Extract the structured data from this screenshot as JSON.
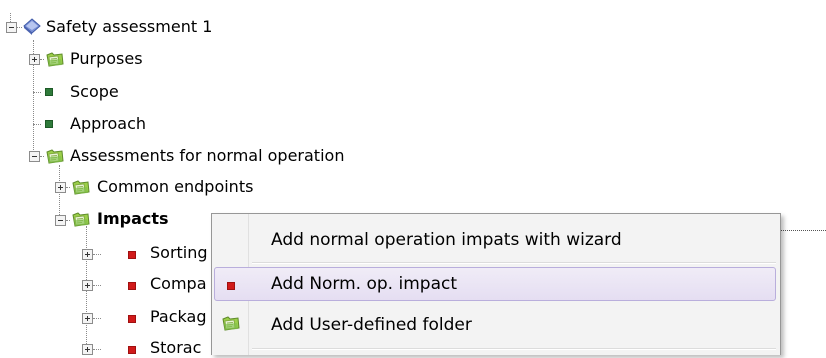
{
  "tree": {
    "root": {
      "label": "Safety assessment 1"
    },
    "purposes": {
      "label": "Purposes"
    },
    "scope": {
      "label": "Scope"
    },
    "approach": {
      "label": "Approach"
    },
    "assessments": {
      "label": "Assessments for normal operation"
    },
    "common_endpoints": {
      "label": "Common endpoints"
    },
    "impacts": {
      "label": "Impacts"
    },
    "children": [
      {
        "label": "Sorting"
      },
      {
        "label": "Compa"
      },
      {
        "label": "Packag"
      },
      {
        "label": "Storac"
      }
    ]
  },
  "context_menu": {
    "items": [
      {
        "label": "Add normal operation impats with wizard",
        "icon": "none"
      },
      {
        "label": "Add Norm. op. impact",
        "icon": "red-square-icon"
      },
      {
        "label": "Add User-defined folder",
        "icon": "folder-icon"
      }
    ],
    "hovered_index": 1
  },
  "colors": {
    "leaf_green": "#2f7a3a",
    "impact_red": "#d11a1a",
    "folder_green": "#8cc63f",
    "menu_bg": "#f3f3f3",
    "hover_border": "#b9aedc"
  }
}
